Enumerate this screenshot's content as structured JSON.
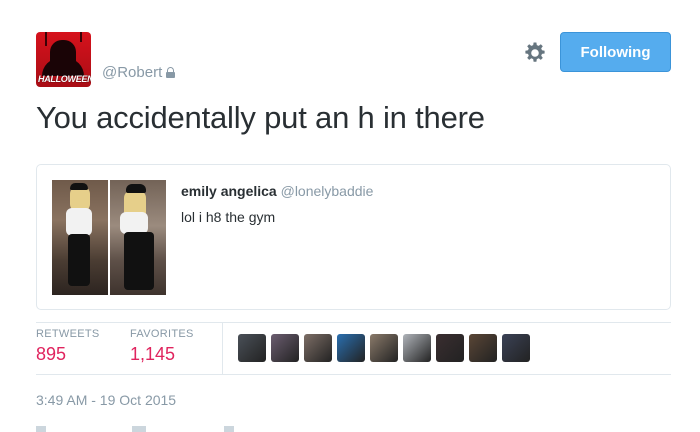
{
  "tweet": {
    "avatar_word": "HALLOWEEN",
    "handle": "@Robert",
    "text": "You accidentally put an h in there",
    "follow_label": "Following",
    "timestamp": "3:49 AM - 19 Oct 2015"
  },
  "quote": {
    "name": "emily angelica",
    "handle": "@lonelybaddie",
    "text": "lol i h8 the gym"
  },
  "stats": {
    "retweets_label": "RETWEETS",
    "retweets": "895",
    "favorites_label": "FAVORITES",
    "favorites": "1,145"
  },
  "favoriter_avatars": [
    "#4a5058",
    "#6b5d70",
    "#7d6e66",
    "#2a6fb0",
    "#8a7a6a",
    "#b0b4ba",
    "#3a2e30",
    "#5a4636",
    "#3b4256"
  ],
  "colors": {
    "accent": "#55acee",
    "like": "#e0245e",
    "muted": "#8899a6"
  },
  "icons": {
    "settings": "gear-icon",
    "protected": "lock-icon"
  }
}
